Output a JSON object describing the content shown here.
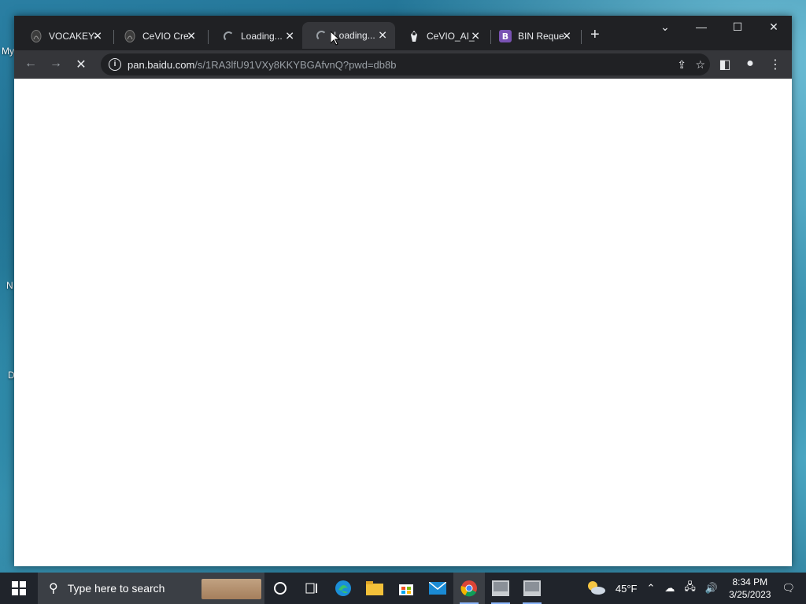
{
  "desktop": {
    "labels": [
      "My",
      "N",
      "D"
    ]
  },
  "browser": {
    "tabs": [
      {
        "title": "VOCAKEY-",
        "favicon": "vocakey-icon",
        "loading": false,
        "active": false
      },
      {
        "title": "CeVIO Cre",
        "favicon": "cevio-icon",
        "loading": false,
        "active": false
      },
      {
        "title": "Loading...",
        "favicon": "loading-spinner",
        "loading": true,
        "active": false
      },
      {
        "title": "Loading...",
        "favicon": "loading-spinner",
        "loading": true,
        "active": true
      },
      {
        "title": "CeVIO_AI_",
        "favicon": "cevio-ai-icon",
        "loading": false,
        "active": false
      },
      {
        "title": "BIN Reque",
        "favicon": "bootstrap-icon",
        "loading": false,
        "active": false
      }
    ],
    "new_tab_label": "+",
    "address": {
      "host": "pan.baidu.com",
      "path": "/s/1RA3lfU91VXy8KKYBGAfvnQ?pwd=db8b"
    },
    "colors": {
      "frame": "#202124",
      "toolbar": "#35363a",
      "page": "#ffffff"
    }
  },
  "taskbar": {
    "search_placeholder": "Type here to search",
    "weather_temp": "45°F",
    "time": "8:34 PM",
    "date": "3/25/2023",
    "apps": [
      "cortana-icon",
      "task-view-icon",
      "edge-icon",
      "file-explorer-icon",
      "store-icon",
      "mail-icon",
      "chrome-icon",
      "app-icon-1",
      "app-icon-2"
    ]
  }
}
